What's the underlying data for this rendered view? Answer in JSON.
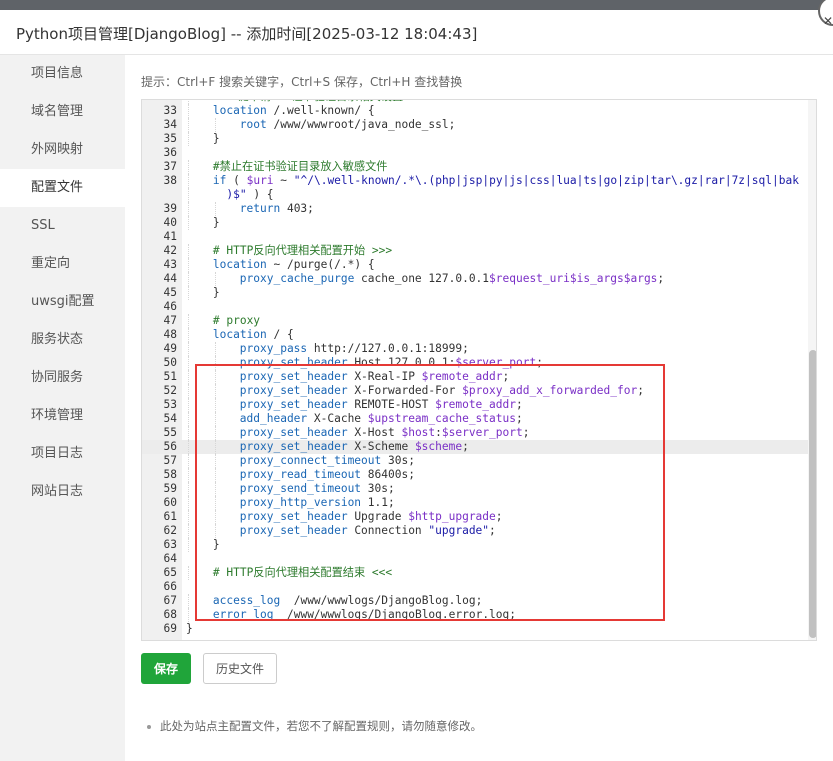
{
  "dialog": {
    "title": "Python项目管理[DjangoBlog] -- 添加时间[2025-03-12 18:04:43]"
  },
  "sidebar": {
    "items": [
      {
        "label": "项目信息",
        "active": false
      },
      {
        "label": "域名管理",
        "active": false
      },
      {
        "label": "外网映射",
        "active": false
      },
      {
        "label": "配置文件",
        "active": true
      },
      {
        "label": "SSL",
        "active": false
      },
      {
        "label": "重定向",
        "active": false
      },
      {
        "label": "uwsgi配置",
        "active": false
      },
      {
        "label": "服务状态",
        "active": false
      },
      {
        "label": "协同服务",
        "active": false
      },
      {
        "label": "环境管理",
        "active": false
      },
      {
        "label": "项目日志",
        "active": false
      },
      {
        "label": "网站日志",
        "active": false
      }
    ]
  },
  "hint": "提示：Ctrl+F 搜索关键字，Ctrl+S 保存，Ctrl+H 查找替换",
  "colors": {
    "keyword": "#1a66b4",
    "variable": "#7a2fc6",
    "comment": "#2c7a2c",
    "string": "#1a1aa6",
    "number": "#000000",
    "highlight_box": "#e53935",
    "save_button": "#20a53a"
  },
  "editor": {
    "highlighted_line": 56,
    "lines": [
      {
        "n": "32",
        "indent": 1,
        "tokens": [
          [
            "c",
            "# 一键申请SSL证书验证目录相关设置"
          ]
        ]
      },
      {
        "n": "33",
        "indent": 1,
        "tokens": [
          [
            "k",
            "location"
          ],
          [
            "t",
            " /.well-known/ {"
          ]
        ]
      },
      {
        "n": "34",
        "indent": 2,
        "tokens": [
          [
            "k",
            "root"
          ],
          [
            "t",
            " /www/wwwroot/java_node_ssl;"
          ]
        ]
      },
      {
        "n": "35",
        "indent": 1,
        "tokens": [
          [
            "t",
            "}"
          ]
        ]
      },
      {
        "n": "36",
        "indent": 0,
        "tokens": []
      },
      {
        "n": "37",
        "indent": 1,
        "tokens": [
          [
            "c",
            "#禁止在证书验证目录放入敏感文件"
          ]
        ]
      },
      {
        "n": "38",
        "indent": 1,
        "tokens": [
          [
            "k",
            "if"
          ],
          [
            "t",
            " ( "
          ],
          [
            "v",
            "$uri"
          ],
          [
            "t",
            " ~ "
          ],
          [
            "s",
            "\"^/\\.well-known/.*\\.(php|jsp|py|js|css|lua|ts|go|zip|tar\\.gz|rar|7z|sql|bak"
          ]
        ]
      },
      {
        "n": "",
        "indent": 1,
        "tokens": [
          [
            "s",
            "  )$\""
          ],
          [
            "t",
            " ) {"
          ]
        ]
      },
      {
        "n": "39",
        "indent": 2,
        "tokens": [
          [
            "k",
            "return"
          ],
          [
            "t",
            " 403;"
          ]
        ]
      },
      {
        "n": "40",
        "indent": 1,
        "tokens": [
          [
            "t",
            "}"
          ]
        ]
      },
      {
        "n": "41",
        "indent": 0,
        "tokens": []
      },
      {
        "n": "42",
        "indent": 1,
        "tokens": [
          [
            "c",
            "# HTTP反向代理相关配置开始 >>>"
          ]
        ]
      },
      {
        "n": "43",
        "indent": 1,
        "tokens": [
          [
            "k",
            "location"
          ],
          [
            "t",
            " ~ /purge(/.*) {"
          ]
        ]
      },
      {
        "n": "44",
        "indent": 2,
        "tokens": [
          [
            "k",
            "proxy_cache_purge"
          ],
          [
            "t",
            " cache_one 127.0.0.1"
          ],
          [
            "v",
            "$request_uri$is_args$args"
          ],
          [
            "t",
            ";"
          ]
        ]
      },
      {
        "n": "45",
        "indent": 1,
        "tokens": [
          [
            "t",
            "}"
          ]
        ]
      },
      {
        "n": "46",
        "indent": 0,
        "tokens": []
      },
      {
        "n": "47",
        "indent": 1,
        "tokens": [
          [
            "c",
            "# proxy"
          ]
        ]
      },
      {
        "n": "48",
        "indent": 1,
        "tokens": [
          [
            "k",
            "location"
          ],
          [
            "t",
            " / {"
          ]
        ]
      },
      {
        "n": "49",
        "indent": 2,
        "tokens": [
          [
            "k",
            "proxy_pass"
          ],
          [
            "t",
            " http://127.0.0.1:18999;"
          ]
        ]
      },
      {
        "n": "50",
        "indent": 2,
        "tokens": [
          [
            "k",
            "proxy_set_header"
          ],
          [
            "t",
            " Host 127.0.0.1:"
          ],
          [
            "v",
            "$server_port"
          ],
          [
            "t",
            ";"
          ]
        ]
      },
      {
        "n": "51",
        "indent": 2,
        "tokens": [
          [
            "k",
            "proxy_set_header"
          ],
          [
            "t",
            " X-Real-IP "
          ],
          [
            "v",
            "$remote_addr"
          ],
          [
            "t",
            ";"
          ]
        ]
      },
      {
        "n": "52",
        "indent": 2,
        "tokens": [
          [
            "k",
            "proxy_set_header"
          ],
          [
            "t",
            " X-Forwarded-For "
          ],
          [
            "v",
            "$proxy_add_x_forwarded_for"
          ],
          [
            "t",
            ";"
          ]
        ]
      },
      {
        "n": "53",
        "indent": 2,
        "tokens": [
          [
            "k",
            "proxy_set_header"
          ],
          [
            "t",
            " REMOTE-HOST "
          ],
          [
            "v",
            "$remote_addr"
          ],
          [
            "t",
            ";"
          ]
        ]
      },
      {
        "n": "54",
        "indent": 2,
        "tokens": [
          [
            "k",
            "add_header"
          ],
          [
            "t",
            " X-Cache "
          ],
          [
            "v",
            "$upstream_cache_status"
          ],
          [
            "t",
            ";"
          ]
        ]
      },
      {
        "n": "55",
        "indent": 2,
        "tokens": [
          [
            "k",
            "proxy_set_header"
          ],
          [
            "t",
            " X-Host "
          ],
          [
            "v",
            "$host"
          ],
          [
            "t",
            ":"
          ],
          [
            "v",
            "$server_port"
          ],
          [
            "t",
            ";"
          ]
        ]
      },
      {
        "n": "56",
        "indent": 2,
        "tokens": [
          [
            "k",
            "proxy_set_header"
          ],
          [
            "t",
            " X-Scheme "
          ],
          [
            "v",
            "$scheme"
          ],
          [
            "t",
            ";"
          ]
        ]
      },
      {
        "n": "57",
        "indent": 2,
        "tokens": [
          [
            "k",
            "proxy_connect_timeout"
          ],
          [
            "t",
            " 30s;"
          ]
        ]
      },
      {
        "n": "58",
        "indent": 2,
        "tokens": [
          [
            "k",
            "proxy_read_timeout"
          ],
          [
            "t",
            " 86400s;"
          ]
        ]
      },
      {
        "n": "59",
        "indent": 2,
        "tokens": [
          [
            "k",
            "proxy_send_timeout"
          ],
          [
            "t",
            " 30s;"
          ]
        ]
      },
      {
        "n": "60",
        "indent": 2,
        "tokens": [
          [
            "k",
            "proxy_http_version"
          ],
          [
            "t",
            " 1.1;"
          ]
        ]
      },
      {
        "n": "61",
        "indent": 2,
        "tokens": [
          [
            "k",
            "proxy_set_header"
          ],
          [
            "t",
            " Upgrade "
          ],
          [
            "v",
            "$http_upgrade"
          ],
          [
            "t",
            ";"
          ]
        ]
      },
      {
        "n": "62",
        "indent": 2,
        "tokens": [
          [
            "k",
            "proxy_set_header"
          ],
          [
            "t",
            " Connection "
          ],
          [
            "s",
            "\"upgrade\""
          ],
          [
            "t",
            ";"
          ]
        ]
      },
      {
        "n": "63",
        "indent": 1,
        "tokens": [
          [
            "t",
            "}"
          ]
        ]
      },
      {
        "n": "64",
        "indent": 0,
        "tokens": []
      },
      {
        "n": "65",
        "indent": 1,
        "tokens": [
          [
            "c",
            "# HTTP反向代理相关配置结束 <<<"
          ]
        ]
      },
      {
        "n": "66",
        "indent": 0,
        "tokens": []
      },
      {
        "n": "67",
        "indent": 1,
        "tokens": [
          [
            "k",
            "access_log"
          ],
          [
            "t",
            "  /www/wwwlogs/DjangoBlog.log;"
          ]
        ]
      },
      {
        "n": "68",
        "indent": 1,
        "tokens": [
          [
            "k",
            "error_log"
          ],
          [
            "t",
            "  /www/wwwlogs/DjangoBlog.error.log;"
          ]
        ]
      },
      {
        "n": "69",
        "indent": 0,
        "tokens": [
          [
            "t",
            "}"
          ]
        ]
      }
    ]
  },
  "buttons": {
    "save": "保存",
    "history": "历史文件"
  },
  "note": "此处为站点主配置文件，若您不了解配置规则，请勿随意修改。"
}
